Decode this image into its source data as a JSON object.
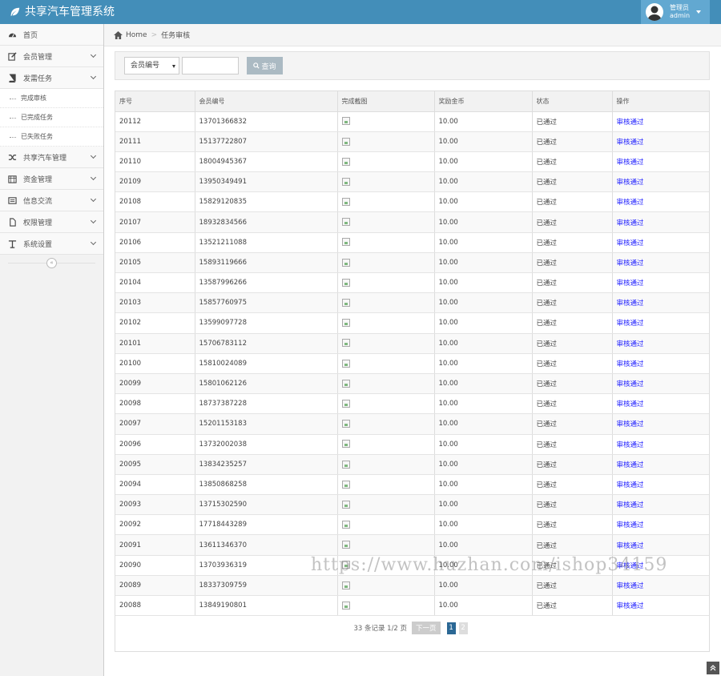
{
  "header": {
    "app_title": "共享汽车管理系统",
    "user_role": "管理员",
    "user_name": "admin",
    "accent": "#438eb9"
  },
  "sidebar": {
    "items": [
      {
        "label": "首页",
        "icon": "dashboard-icon"
      },
      {
        "label": "会员管理",
        "icon": "edit-icon"
      },
      {
        "label": "发需任务",
        "icon": "book-icon"
      },
      {
        "label": "共享汽车管理",
        "icon": "shuffle-icon"
      },
      {
        "label": "资金管理",
        "icon": "calendar-icon"
      },
      {
        "label": "信息交流",
        "icon": "list-icon"
      },
      {
        "label": "权限管理",
        "icon": "file-icon"
      },
      {
        "label": "系统设置",
        "icon": "text-icon"
      }
    ],
    "sub_items": [
      "完成审核",
      "已完成任务",
      "已失败任务"
    ],
    "collapse_symbol": "«"
  },
  "breadcrumb": {
    "home": "Home",
    "current": "任务审核"
  },
  "search": {
    "select_value": "会员编号",
    "input_value": "",
    "button_label": "查询"
  },
  "table": {
    "columns": [
      "序号",
      "会员编号",
      "完成截图",
      "奖励金币",
      "状态",
      "操作"
    ],
    "rows": [
      [
        "20112",
        "13701366832",
        "10.00",
        "已通过",
        "审核通过"
      ],
      [
        "20111",
        "15137722807",
        "10.00",
        "已通过",
        "审核通过"
      ],
      [
        "20110",
        "18004945367",
        "10.00",
        "已通过",
        "审核通过"
      ],
      [
        "20109",
        "13950349491",
        "10.00",
        "已通过",
        "审核通过"
      ],
      [
        "20108",
        "15829120835",
        "10.00",
        "已通过",
        "审核通过"
      ],
      [
        "20107",
        "18932834566",
        "10.00",
        "已通过",
        "审核通过"
      ],
      [
        "20106",
        "13521211088",
        "10.00",
        "已通过",
        "审核通过"
      ],
      [
        "20105",
        "15893119666",
        "10.00",
        "已通过",
        "审核通过"
      ],
      [
        "20104",
        "13587996266",
        "10.00",
        "已通过",
        "审核通过"
      ],
      [
        "20103",
        "15857760975",
        "10.00",
        "已通过",
        "审核通过"
      ],
      [
        "20102",
        "13599097728",
        "10.00",
        "已通过",
        "审核通过"
      ],
      [
        "20101",
        "15706783112",
        "10.00",
        "已通过",
        "审核通过"
      ],
      [
        "20100",
        "15810024089",
        "10.00",
        "已通过",
        "审核通过"
      ],
      [
        "20099",
        "15801062126",
        "10.00",
        "已通过",
        "审核通过"
      ],
      [
        "20098",
        "18737387228",
        "10.00",
        "已通过",
        "审核通过"
      ],
      [
        "20097",
        "15201153183",
        "10.00",
        "已通过",
        "审核通过"
      ],
      [
        "20096",
        "13732002038",
        "10.00",
        "已通过",
        "审核通过"
      ],
      [
        "20095",
        "13834235257",
        "10.00",
        "已通过",
        "审核通过"
      ],
      [
        "20094",
        "13850868258",
        "10.00",
        "已通过",
        "审核通过"
      ],
      [
        "20093",
        "13715302590",
        "10.00",
        "已通过",
        "审核通过"
      ],
      [
        "20092",
        "17718443289",
        "10.00",
        "已通过",
        "审核通过"
      ],
      [
        "20091",
        "13611346370",
        "10.00",
        "已通过",
        "审核通过"
      ],
      [
        "20090",
        "13703936319",
        "10.00",
        "已通过",
        "审核通过"
      ],
      [
        "20089",
        "18337309759",
        "10.00",
        "已通过",
        "审核通过"
      ],
      [
        "20088",
        "13849190801",
        "10.00",
        "已通过",
        "审核通过"
      ]
    ]
  },
  "pagination": {
    "info": "33 条记录 1/2 页",
    "next_label": "下一页",
    "pages": [
      "1",
      "2"
    ],
    "current_page": "1"
  },
  "watermark": "https://www.huzhan.com/ishop34159"
}
